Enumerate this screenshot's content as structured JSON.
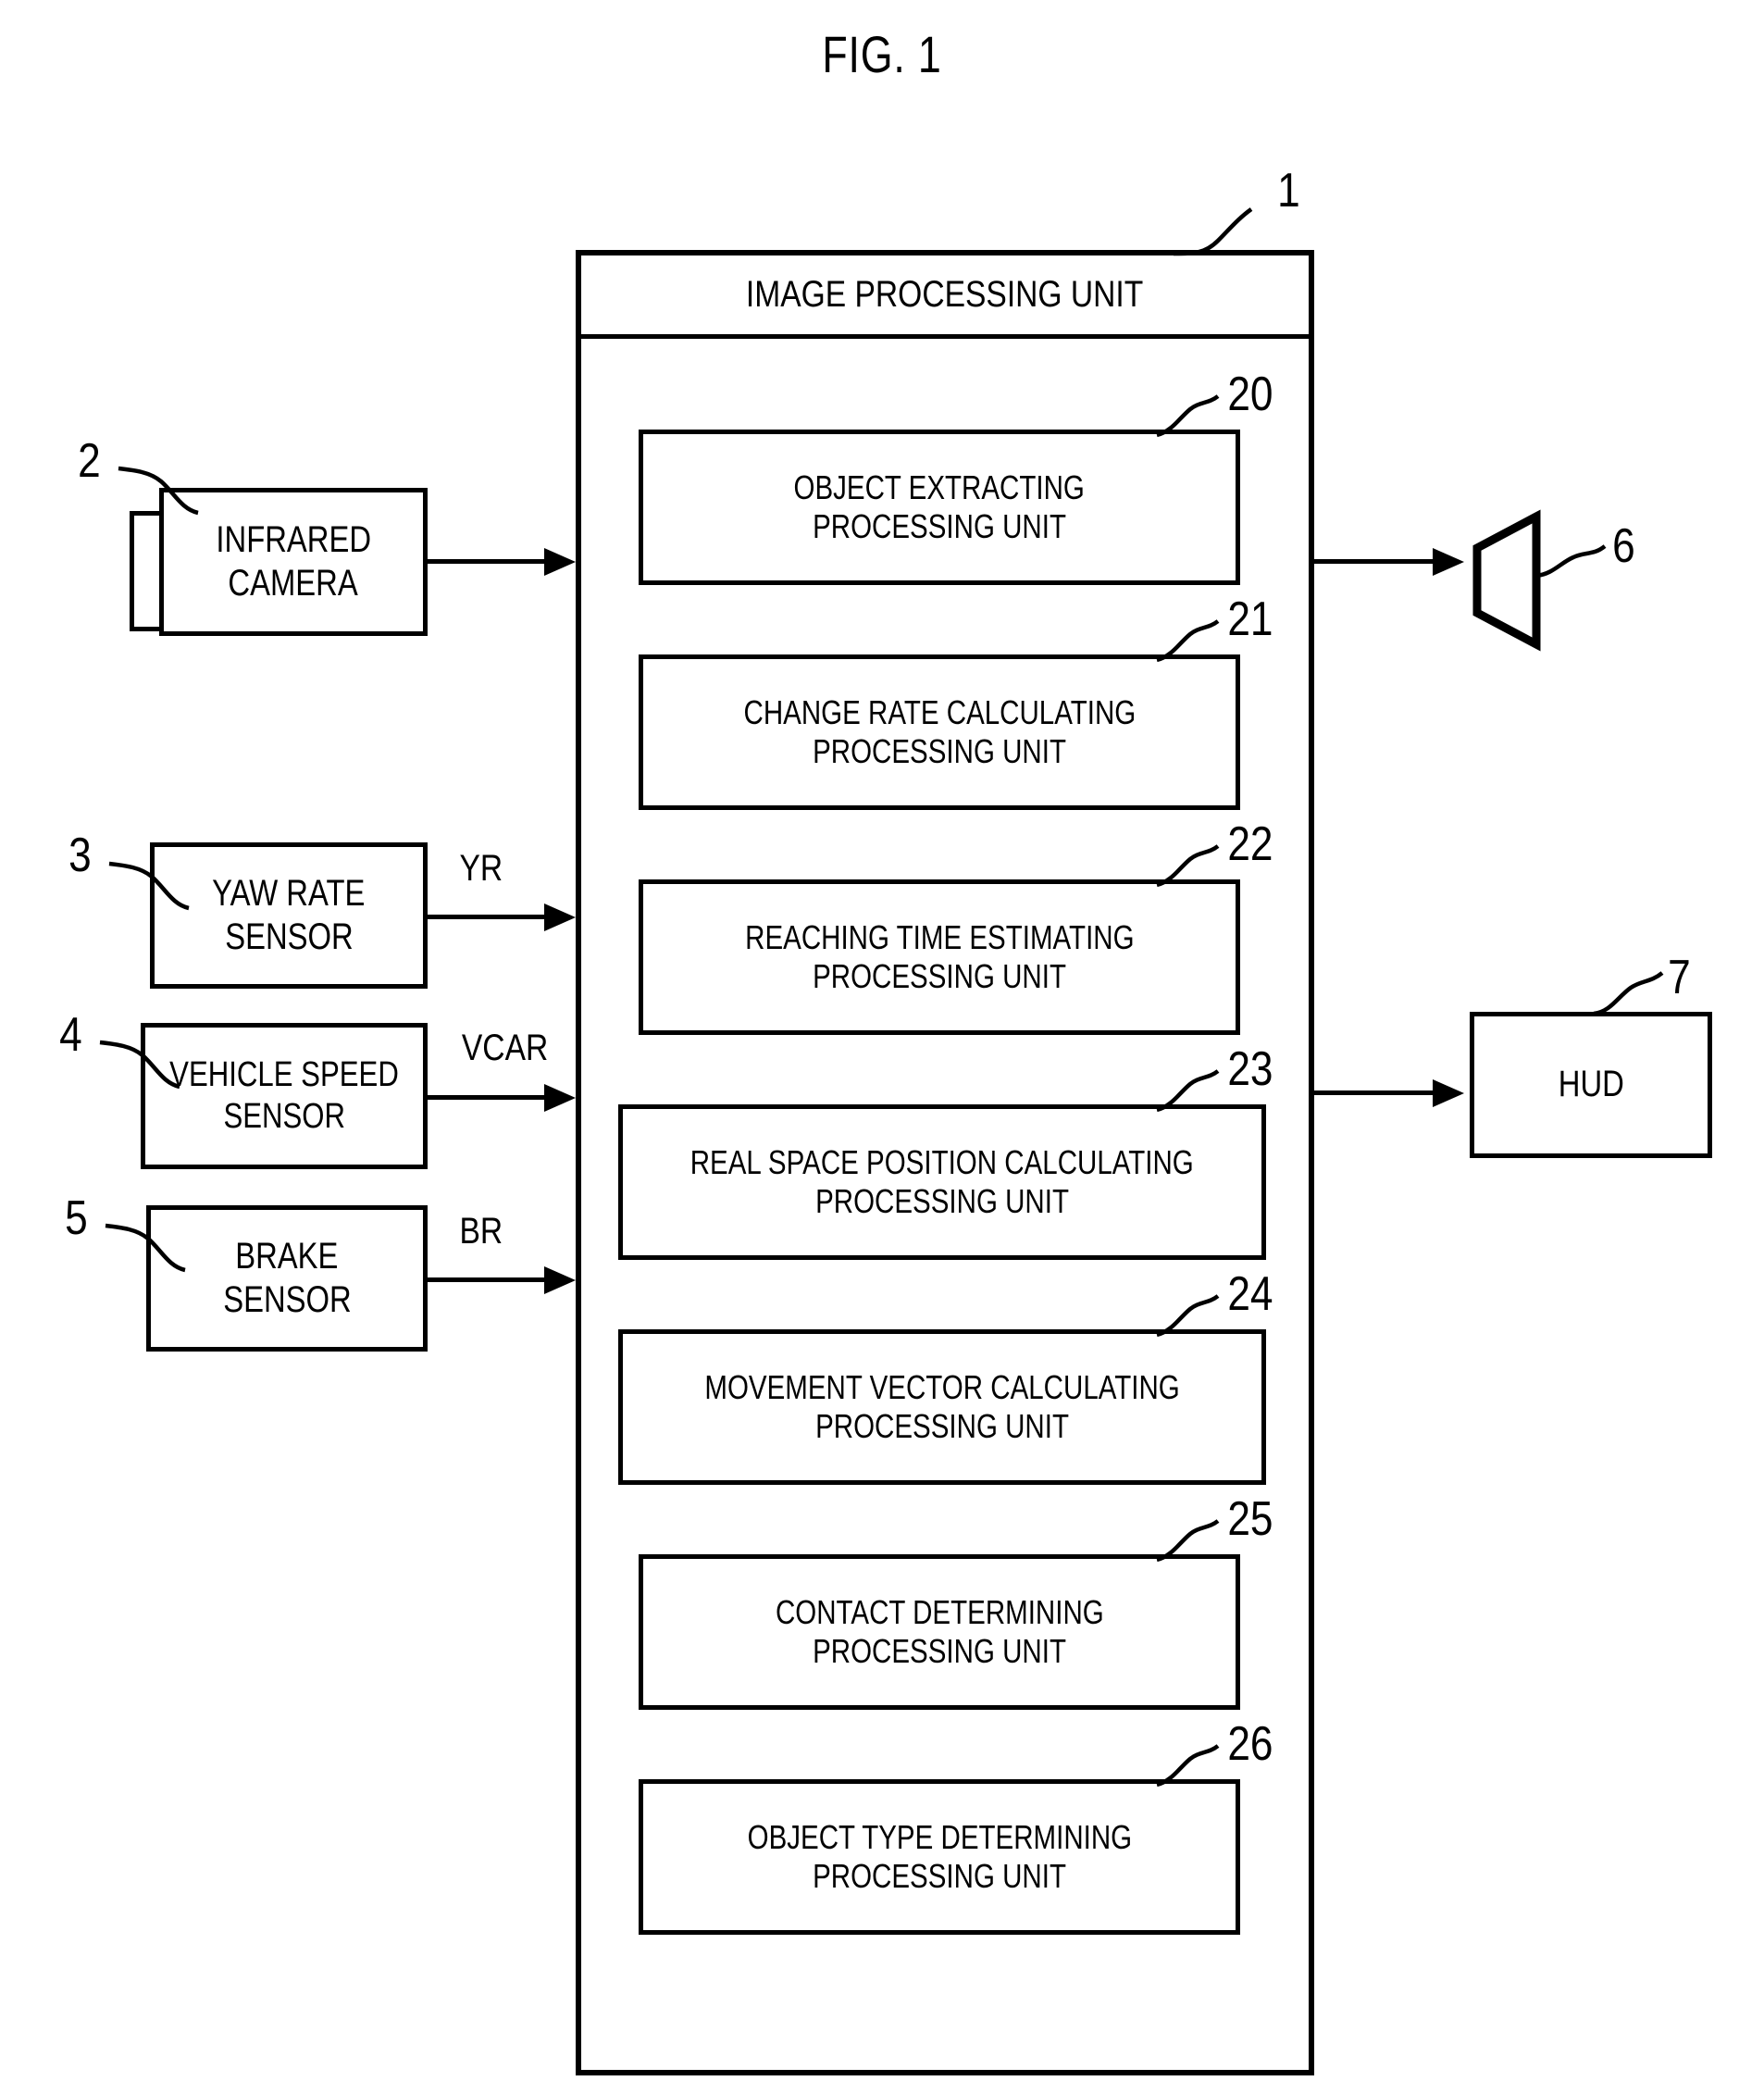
{
  "figure": {
    "title": "FIG. 1"
  },
  "main_unit": {
    "ref": "1",
    "title": "IMAGE PROCESSING UNIT",
    "modules": [
      {
        "ref": "20",
        "line1": "OBJECT EXTRACTING",
        "line2": "PROCESSING UNIT"
      },
      {
        "ref": "21",
        "line1": "CHANGE RATE CALCULATING",
        "line2": "PROCESSING UNIT"
      },
      {
        "ref": "22",
        "line1": "REACHING TIME ESTIMATING",
        "line2": "PROCESSING UNIT"
      },
      {
        "ref": "23",
        "line1": "REAL SPACE POSITION CALCULATING",
        "line2": "PROCESSING UNIT"
      },
      {
        "ref": "24",
        "line1": "MOVEMENT VECTOR CALCULATING",
        "line2": "PROCESSING UNIT"
      },
      {
        "ref": "25",
        "line1": "CONTACT DETERMINING",
        "line2": "PROCESSING UNIT"
      },
      {
        "ref": "26",
        "line1": "OBJECT TYPE DETERMINING",
        "line2": "PROCESSING UNIT"
      }
    ]
  },
  "inputs": [
    {
      "ref": "2",
      "line1": "INFRARED",
      "line2": "CAMERA",
      "signal": ""
    },
    {
      "ref": "3",
      "line1": "YAW RATE",
      "line2": "SENSOR",
      "signal": "YR"
    },
    {
      "ref": "4",
      "line1": "VEHICLE SPEED",
      "line2": "SENSOR",
      "signal": "VCAR"
    },
    {
      "ref": "5",
      "line1": "BRAKE",
      "line2": "SENSOR",
      "signal": "BR"
    }
  ],
  "outputs": [
    {
      "ref": "6",
      "label": "",
      "icon": "speaker-icon"
    },
    {
      "ref": "7",
      "label": "HUD",
      "icon": ""
    }
  ],
  "colors": {
    "line": "#000000",
    "background": "#ffffff"
  }
}
